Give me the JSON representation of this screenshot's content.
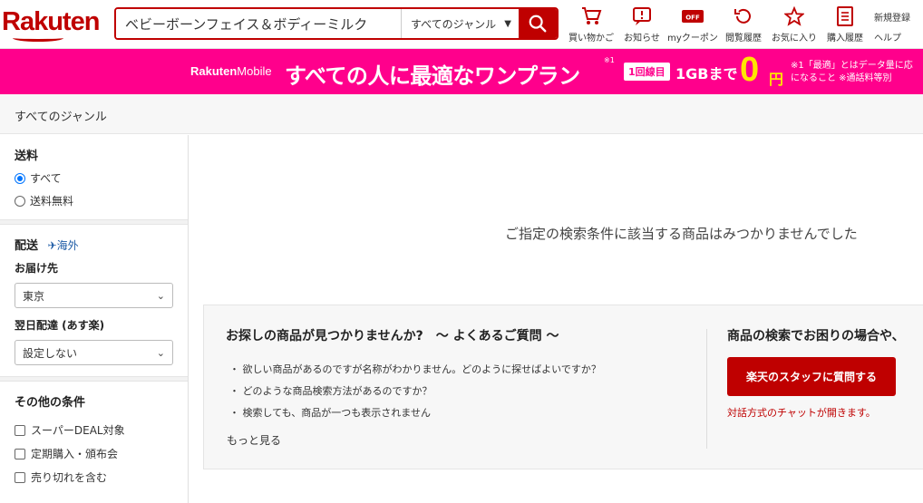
{
  "header": {
    "logo": "Rakuten",
    "search_value": "ベビーボーンフェイス＆ボディーミルク",
    "genre": "すべてのジャンル",
    "nav": [
      {
        "label": "買い物かご",
        "icon": "cart-icon"
      },
      {
        "label": "お知らせ",
        "icon": "notice-icon"
      },
      {
        "label": "myクーポン",
        "icon": "coupon-icon"
      },
      {
        "label": "閲覧履歴",
        "icon": "history-icon"
      },
      {
        "label": "お気に入り",
        "icon": "star-icon"
      },
      {
        "label": "購入履歴",
        "icon": "receipt-icon"
      },
      {
        "label": "新規登録",
        "icon": "register-icon"
      },
      {
        "label": "ヘルプ",
        "icon": "help-icon"
      }
    ]
  },
  "banner": {
    "brand_bold": "Rakuten",
    "brand_rest": "Mobile",
    "headline": "すべての人に最適なワンプラン",
    "sup": "※1",
    "tag": "1回線目",
    "gb": "1GBまで",
    "zero": "0",
    "yen": "円",
    "note_line1": "※1「最適」とはデータ量に応",
    "note_line2": "になること ※通話料等別"
  },
  "breadcrumb": "すべてのジャンル",
  "sidebar": {
    "shipping_title": "送料",
    "shipping_options": [
      {
        "label": "すべて",
        "selected": true
      },
      {
        "label": "送料無料",
        "selected": false
      }
    ],
    "delivery_title": "配送",
    "abroad": "海外",
    "destination_title": "お届け先",
    "destination_value": "東京",
    "nextday_title": "翌日配達 (あす楽)",
    "nextday_value": "設定しない",
    "other_title": "その他の条件",
    "other_options": [
      "スーパーDEAL対象",
      "定期購入・頒布会",
      "売り切れを含む"
    ]
  },
  "main": {
    "no_result": "ご指定の検索条件に該当する商品はみつかりませんでした",
    "help_title": "お探しの商品が見つかりませんか?　～ よくあるご質問 ～",
    "faq": [
      "・ 欲しい商品があるのですが名称がわかりません。どのように探せばよいですか？",
      "・ どのような商品検索方法があるのですか？",
      "・ 検索しても、商品が一つも表示されません"
    ],
    "more": "もっと見る",
    "help_title2": "商品の検索でお困りの場合や、",
    "staff_button": "楽天のスタッフに質問する",
    "chat_note": "対話方式のチャットが開きます。"
  },
  "colors": {
    "brand": "#bf0000",
    "banner": "#ff008c",
    "accent_yellow": "#ffe500"
  }
}
